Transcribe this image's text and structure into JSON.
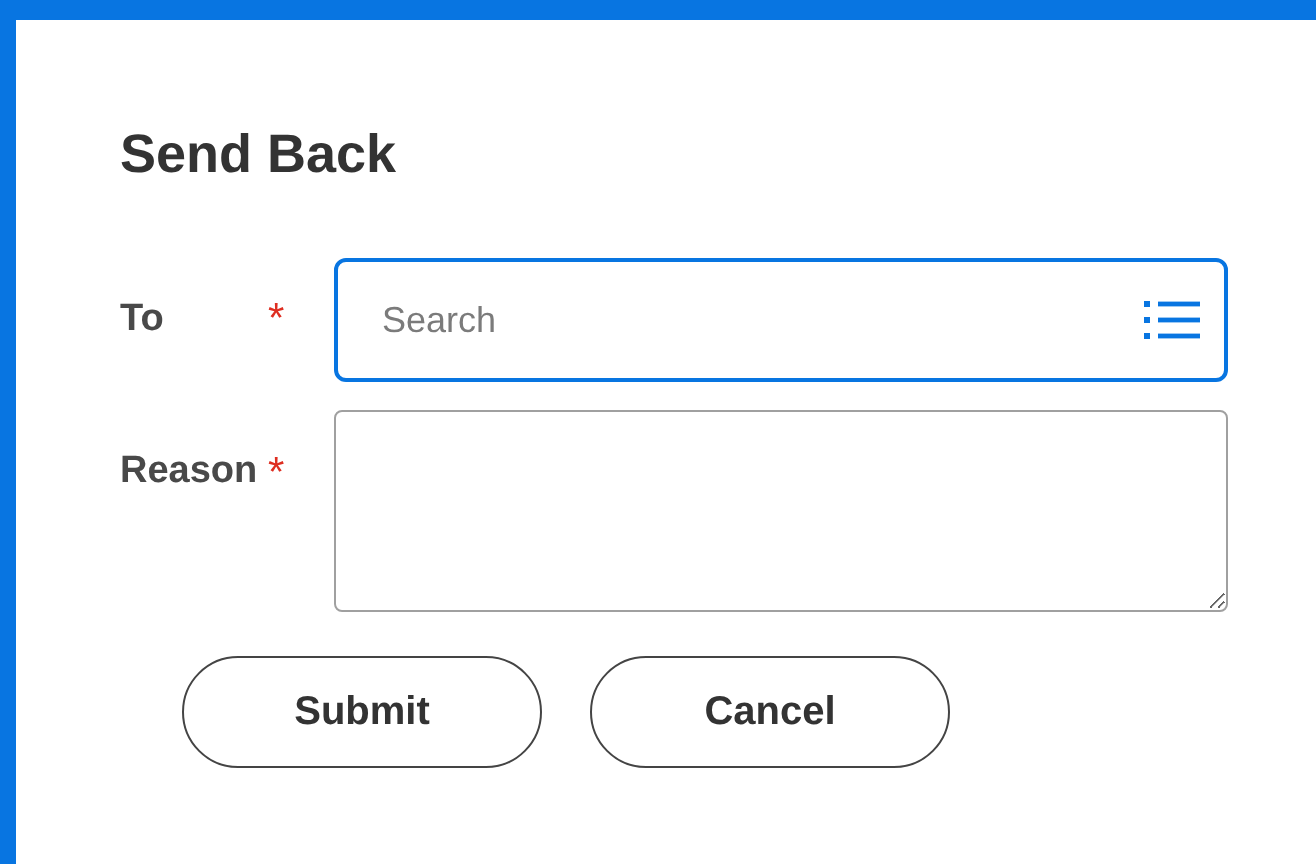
{
  "dialog": {
    "title": "Send Back"
  },
  "fields": [
    {
      "kind": "search",
      "label": "To",
      "required": true,
      "marker": "*",
      "placeholder": "Search",
      "focused": true
    },
    {
      "kind": "textarea",
      "label": "Reason",
      "required": true,
      "marker": "*",
      "focused": false
    }
  ],
  "buttons": [
    "Submit",
    "Cancel"
  ]
}
